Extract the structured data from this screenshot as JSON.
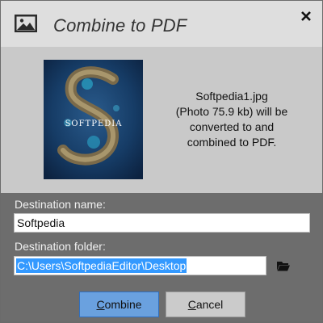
{
  "dialog": {
    "title": "Combine to PDF",
    "icon": "image-icon",
    "close_icon": "close-icon"
  },
  "preview": {
    "thumbnail_caption": "SOFTPEDIA",
    "info_lines": [
      "Softpedia1.jpg",
      "(Photo 75.9 kb) will be",
      "converted to and",
      "combined to PDF."
    ]
  },
  "destination_name": {
    "label": "Destination name:",
    "value": "Softpedia"
  },
  "destination_folder": {
    "label": "Destination folder:",
    "value": "C:\\Users\\SoftpediaEditor\\Desktop",
    "browse_icon": "folder-icon"
  },
  "buttons": {
    "combine_mnemonic": "C",
    "combine_rest": "ombine",
    "cancel_mnemonic": "C",
    "cancel_rest": "ancel"
  },
  "colors": {
    "titlebar": "#dedede",
    "content": "#c9c9c9",
    "body": "#6d6d6d",
    "primary_button": "#6aa1df",
    "selection": "#3399ff"
  }
}
